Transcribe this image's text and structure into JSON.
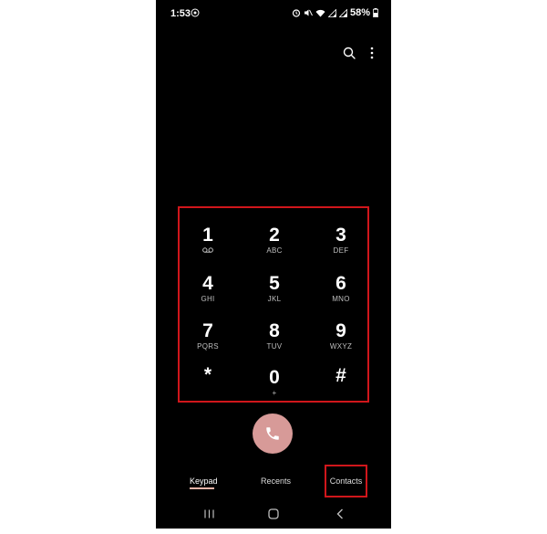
{
  "status_bar": {
    "time": "1:53",
    "battery": "58%"
  },
  "keypad": {
    "keys": [
      {
        "digit": "1",
        "letters": "",
        "icon": "voicemail-icon"
      },
      {
        "digit": "2",
        "letters": "ABC"
      },
      {
        "digit": "3",
        "letters": "DEF"
      },
      {
        "digit": "4",
        "letters": "GHI"
      },
      {
        "digit": "5",
        "letters": "JKL"
      },
      {
        "digit": "6",
        "letters": "MNO"
      },
      {
        "digit": "7",
        "letters": "PQRS"
      },
      {
        "digit": "8",
        "letters": "TUV"
      },
      {
        "digit": "9",
        "letters": "WXYZ"
      },
      {
        "digit": "*",
        "letters": ""
      },
      {
        "digit": "0",
        "letters": "+"
      },
      {
        "digit": "#",
        "letters": ""
      }
    ]
  },
  "tabs": {
    "keypad": "Keypad",
    "recents": "Recents",
    "contacts": "Contacts"
  },
  "colors": {
    "background": "#000000",
    "call_button": "#d79a98",
    "highlight_border": "#d0161b",
    "active_tab_underline": "#e8b4a8"
  },
  "icons": {
    "search": "search-icon",
    "more": "more-vertical-icon",
    "call": "phone-icon",
    "nav_recent": "recent-apps-icon",
    "nav_home": "home-icon",
    "nav_back": "back-icon"
  }
}
